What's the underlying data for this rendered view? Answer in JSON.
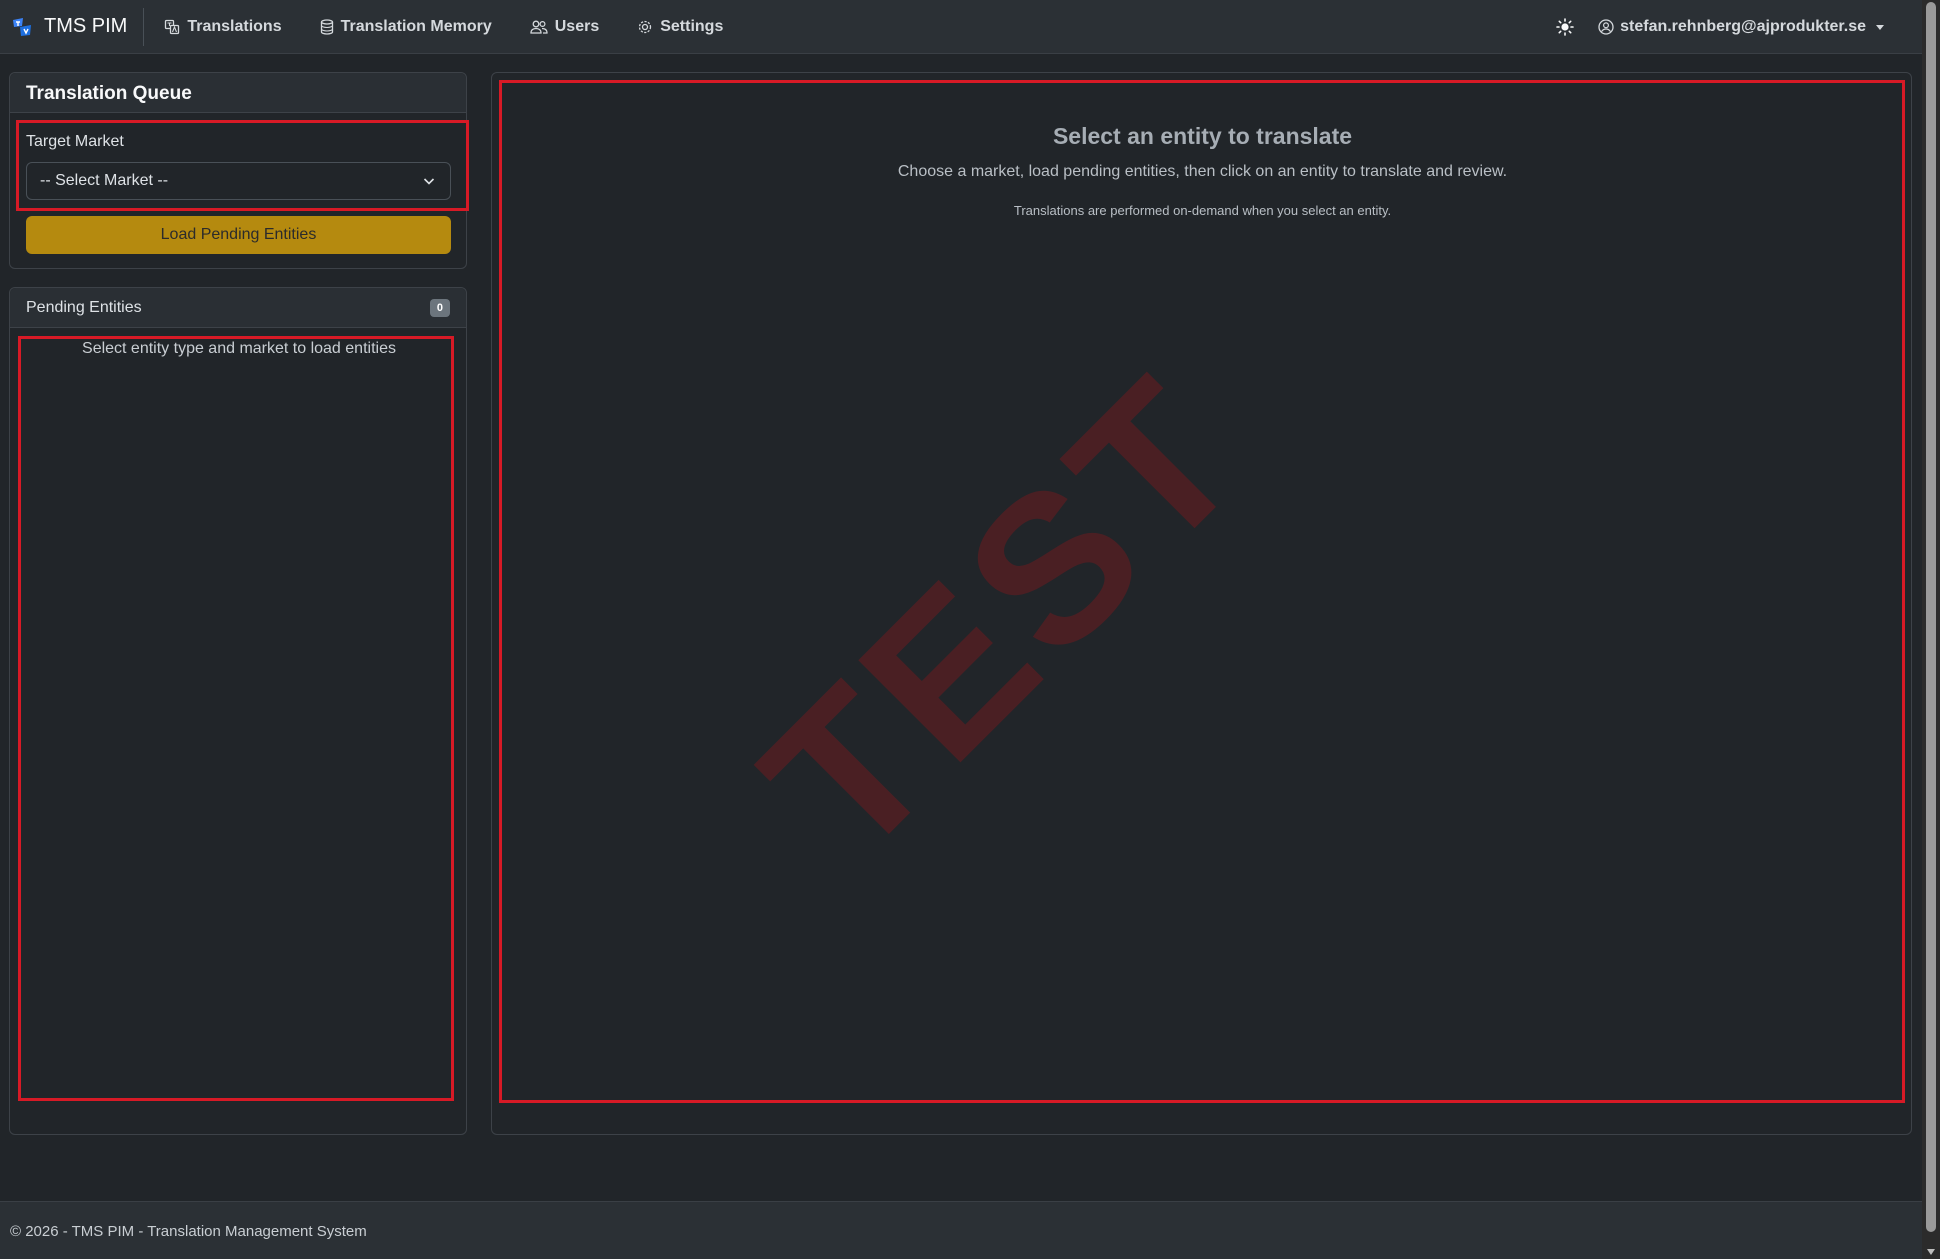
{
  "app": {
    "brand": "TMS PIM",
    "nav": [
      {
        "label": "Translations",
        "icon": "translate-icon"
      },
      {
        "label": "Translation Memory",
        "icon": "database-icon"
      },
      {
        "label": "Users",
        "icon": "people-icon"
      },
      {
        "label": "Settings",
        "icon": "gear-icon"
      }
    ],
    "user_email": "stefan.rehnberg@ajprodukter.se"
  },
  "queue": {
    "title": "Translation Queue",
    "target_label": "Target Market",
    "select_value": "-- Select Market --",
    "load_button": "Load Pending Entities"
  },
  "pending": {
    "title": "Pending Entities",
    "count": "0",
    "empty_text": "Select entity type and market to load entities"
  },
  "main": {
    "title": "Select an entity to translate",
    "subtitle": "Choose a market, load pending entities, then click on an entity to translate and review.",
    "note": "Translations are performed on-demand when you select an entity."
  },
  "watermark": "TEST",
  "footer": "© 2026 - TMS PIM - Translation Management System",
  "colors": {
    "accent_button": "#b58a0f",
    "highlight_border": "#d71a26",
    "background": "#212529"
  }
}
